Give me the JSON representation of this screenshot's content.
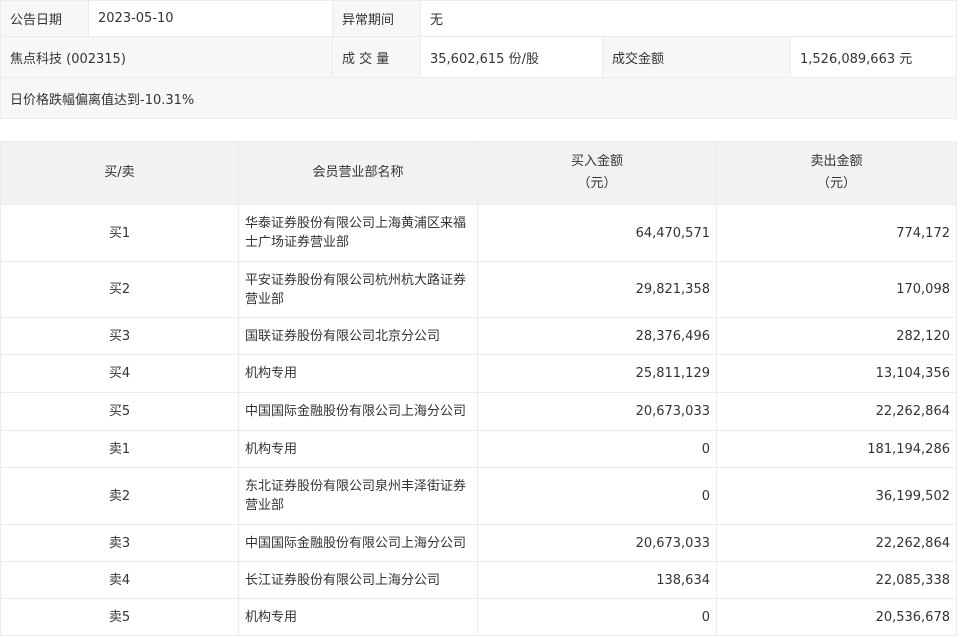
{
  "info": {
    "announce_date_label": "公告日期",
    "announce_date": "2023-05-10",
    "abnormal_period_label": "异常期间",
    "abnormal_period": "无",
    "stock": "焦点科技 (002315)",
    "volume_label": "成 交 量",
    "volume": "35,602,615 份/股",
    "amount_label": "成交金额",
    "amount": "1,526,089,663 元",
    "reason": "日价格跌幅偏离值达到-10.31%"
  },
  "table": {
    "headers": {
      "side": "买/卖",
      "member": "会员营业部名称",
      "buy_title": "买入金额",
      "buy_unit": "（元）",
      "sell_title": "卖出金额",
      "sell_unit": "（元）"
    },
    "rows": [
      {
        "side": "买1",
        "member": "华泰证券股份有限公司上海黄浦区来福士广场证券营业部",
        "buy": "64,470,571",
        "sell": "774,172"
      },
      {
        "side": "买2",
        "member": "平安证券股份有限公司杭州杭大路证券营业部",
        "buy": "29,821,358",
        "sell": "170,098"
      },
      {
        "side": "买3",
        "member": "国联证券股份有限公司北京分公司",
        "buy": "28,376,496",
        "sell": "282,120"
      },
      {
        "side": "买4",
        "member": "机构专用",
        "buy": "25,811,129",
        "sell": "13,104,356"
      },
      {
        "side": "买5",
        "member": "中国国际金融股份有限公司上海分公司",
        "buy": "20,673,033",
        "sell": "22,262,864"
      },
      {
        "side": "卖1",
        "member": "机构专用",
        "buy": "0",
        "sell": "181,194,286"
      },
      {
        "side": "卖2",
        "member": "东北证券股份有限公司泉州丰泽街证券营业部",
        "buy": "0",
        "sell": "36,199,502"
      },
      {
        "side": "卖3",
        "member": "中国国际金融股份有限公司上海分公司",
        "buy": "20,673,033",
        "sell": "22,262,864"
      },
      {
        "side": "卖4",
        "member": "长江证券股份有限公司上海分公司",
        "buy": "138,634",
        "sell": "22,085,338"
      },
      {
        "side": "卖5",
        "member": "机构专用",
        "buy": "0",
        "sell": "20,536,678"
      }
    ]
  }
}
